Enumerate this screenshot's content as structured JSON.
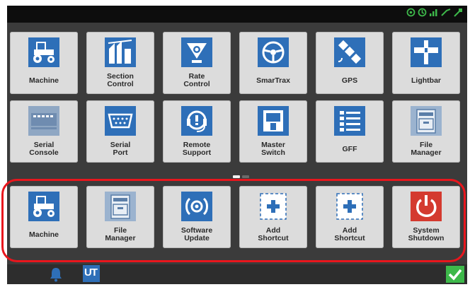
{
  "page_indicator": {
    "pages": 2,
    "current": 1
  },
  "tiles_page": [
    {
      "id": "machine",
      "label": "Machine",
      "icon": "tractor-icon"
    },
    {
      "id": "section-control",
      "label": "Section\nControl",
      "icon": "section-control-icon"
    },
    {
      "id": "rate-control",
      "label": "Rate\nControl",
      "icon": "rate-control-icon"
    },
    {
      "id": "smartrax",
      "label": "SmarTrax",
      "icon": "steering-wheel-icon"
    },
    {
      "id": "gps",
      "label": "GPS",
      "icon": "satellite-icon"
    },
    {
      "id": "lightbar",
      "label": "Lightbar",
      "icon": "lightbar-icon"
    },
    {
      "id": "serial-console",
      "label": "Serial\nConsole",
      "icon": "serial-console-icon"
    },
    {
      "id": "serial-port",
      "label": "Serial\nPort",
      "icon": "serial-port-icon"
    },
    {
      "id": "remote-support",
      "label": "Remote\nSupport",
      "icon": "headset-icon"
    },
    {
      "id": "master-switch",
      "label": "Master\nSwitch",
      "icon": "switch-icon"
    },
    {
      "id": "gff",
      "label": "GFF",
      "icon": "gff-icon"
    },
    {
      "id": "file-manager",
      "label": "File\nManager",
      "icon": "file-cabinet-icon"
    }
  ],
  "shortcuts": [
    {
      "id": "machine",
      "label": "Machine",
      "icon": "tractor-icon"
    },
    {
      "id": "file-manager",
      "label": "File\nManager",
      "icon": "file-cabinet-icon"
    },
    {
      "id": "software-update",
      "label": "Software\nUpdate",
      "icon": "software-update-icon"
    },
    {
      "id": "add-shortcut-1",
      "label": "Add\nShortcut",
      "icon": "add-icon"
    },
    {
      "id": "add-shortcut-2",
      "label": "Add\nShortcut",
      "icon": "add-icon"
    },
    {
      "id": "system-shutdown",
      "label": "System\nShutdown",
      "icon": "power-icon"
    }
  ],
  "bottom_bar": {
    "ut_label": "UT"
  },
  "status_icons": [
    "gps-status-icon",
    "gps-status-icon",
    "signal-bars-icon",
    "steering-status-icon",
    "satellite-status-icon"
  ],
  "colors": {
    "accent_blue": "#2e6fb8",
    "status_green": "#3db84a",
    "shutdown_red": "#d43a2f",
    "highlight_red": "#e8161d"
  }
}
